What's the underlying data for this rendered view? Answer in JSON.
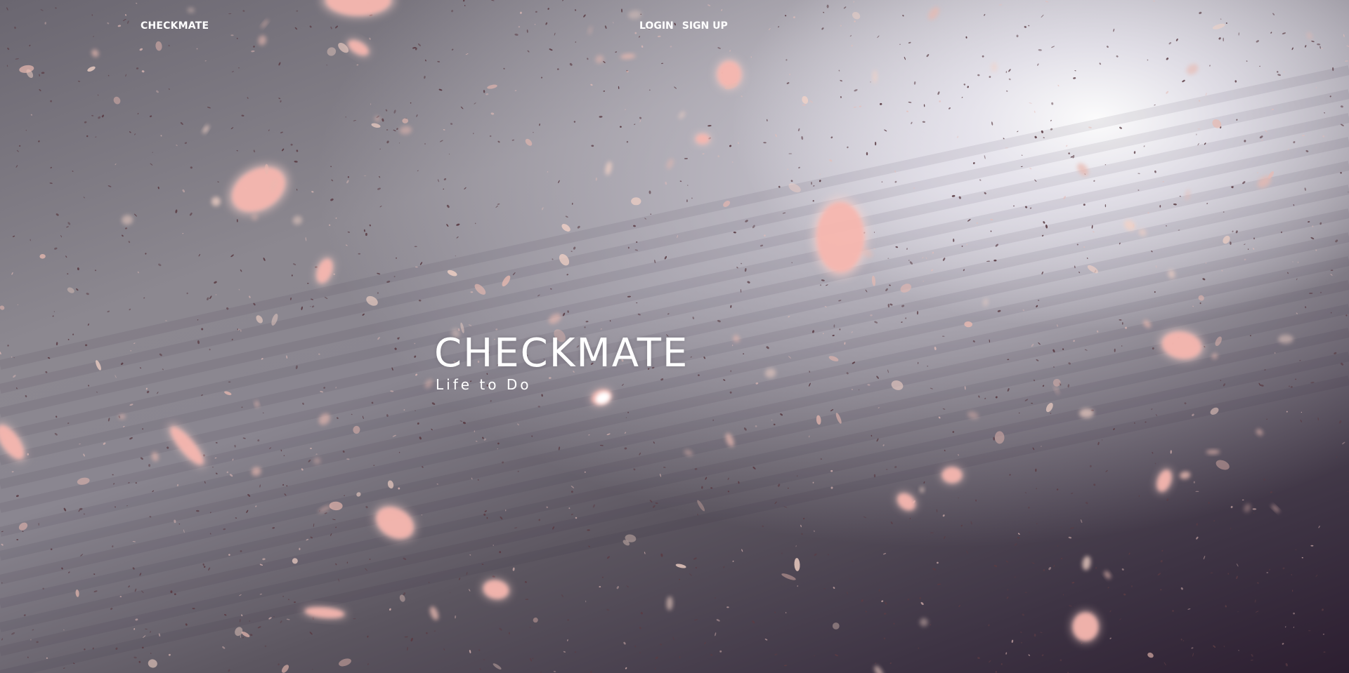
{
  "nav": {
    "brand": "CHECKMATE",
    "login_label": "LOGIN",
    "signup_label": "SIGN UP"
  },
  "hero": {
    "title": "CHECKMATE",
    "subtitle": "Life to Do"
  },
  "colors": {
    "petal": "#f7b6ae",
    "petal_glow": "#ffd6cf",
    "speck": "#5a3c44",
    "text": "#ffffff"
  }
}
